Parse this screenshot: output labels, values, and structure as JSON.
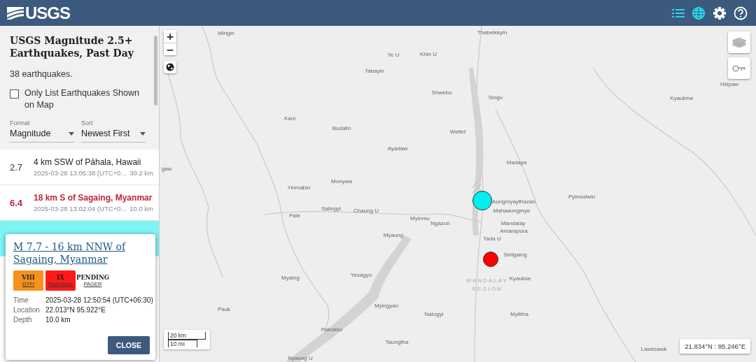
{
  "header": {
    "logo": "USGS",
    "buttons": [
      {
        "kind": "list",
        "selected": true
      },
      {
        "kind": "map",
        "selected": true
      },
      {
        "kind": "settings",
        "selected": false
      },
      {
        "kind": "help",
        "selected": false
      }
    ]
  },
  "sidebar": {
    "title": "USGS Magnitude 2.5+ Earthquakes, Past Day",
    "count": "38 earthquakes.",
    "filter": {
      "label": "Only List Earthquakes Shown on Map",
      "checked": false
    },
    "format": {
      "label": "Format",
      "value": "Magnitude"
    },
    "sort": {
      "label": "Sort",
      "value": "Newest First"
    },
    "events": [
      {
        "kind": "normal",
        "selected": false,
        "magnitude": "2.7",
        "title": "4 km SSW of Pāhala, Hawaii",
        "time": "2025-03-28 13:05:38 (UTC+0…",
        "depth": "30.2 km"
      },
      {
        "kind": "significant",
        "selected": false,
        "magnitude": "6.4",
        "title": "18 km S of Sagaing, Myanmar",
        "time": "2025-03-28 13:02:04 (UTC+0…",
        "depth": "10.0 km"
      },
      {
        "kind": "normal",
        "selected": true
      }
    ]
  },
  "popup": {
    "title": "M 7.7 - 16 km NNW of Sagaing, Myanmar",
    "badges": [
      {
        "value": "VIII",
        "label": "DYFI",
        "color": "#f7901e"
      },
      {
        "value": "IX",
        "label": "ShakeMap",
        "color": "#ff1a1a"
      },
      {
        "value": "PENDING",
        "label": "PAGER",
        "color": "#ffffff"
      }
    ],
    "details": [
      {
        "label": "Time",
        "value": "2025-03-28 12:50:54 (UTC+06:30)"
      },
      {
        "label": "Location",
        "value": "22.013°N 95.922°E"
      },
      {
        "label": "Depth",
        "value": "10.0 km"
      }
    ],
    "close": "CLOSE"
  },
  "map": {
    "zoom_in": "+",
    "zoom_out": "−",
    "scale": [
      "20 km",
      "10 mi"
    ],
    "coordinates": "21.834°N : 95.246°E",
    "markers": [
      {
        "color": "#00f0f0",
        "selected": true
      },
      {
        "color": "#ff0000",
        "selected": false
      }
    ],
    "places": [
      "Mingin",
      "Thabeikkyin",
      "Ye U",
      "Khin U",
      "Tabayin",
      "Shwebo",
      "Singu",
      "Hsipaw",
      "Kyaukme",
      "Kani",
      "Budalin",
      "Wetlet",
      "Ayadaw",
      "gaw",
      "Madaya",
      "Monywa",
      "Yinmabin",
      "Aungmyaythazan",
      "Pyinoolwin",
      "Mahaaungmye",
      "Salingyi",
      "Chaung U",
      "Pale",
      "Myinmu",
      "Ngazun",
      "Mandalay",
      "Amarapura",
      "Myaung",
      "Tada U",
      "Sintgaing",
      "Yesagyo",
      "Kyaukse",
      "Myaing",
      "Myittha",
      "Myingyan",
      "Natogyi",
      "Pauk",
      "Pakokku",
      "Taungtha",
      "Lawksawk",
      "Nyaung U"
    ],
    "region": "MANDALAY REGION"
  }
}
